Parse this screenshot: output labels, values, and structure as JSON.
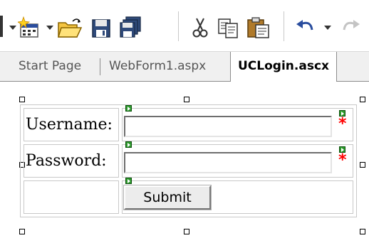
{
  "toolbar": {
    "icons": [
      "new-project-icon",
      "open-file-icon",
      "save-icon",
      "save-all-icon",
      "cut-icon",
      "copy-icon",
      "paste-icon",
      "undo-icon",
      "redo-icon"
    ]
  },
  "tabs": [
    {
      "label": "Start Page",
      "active": false
    },
    {
      "label": "WebForm1.aspx",
      "active": false
    },
    {
      "label": "UCLogin.ascx",
      "active": true
    }
  ],
  "form": {
    "username_label": "Username:",
    "password_label": "Password:",
    "required_marker": "*",
    "submit_label": "Submit"
  },
  "colors": {
    "required": "#ff0000",
    "smart_tag": "#2c9b2c"
  }
}
